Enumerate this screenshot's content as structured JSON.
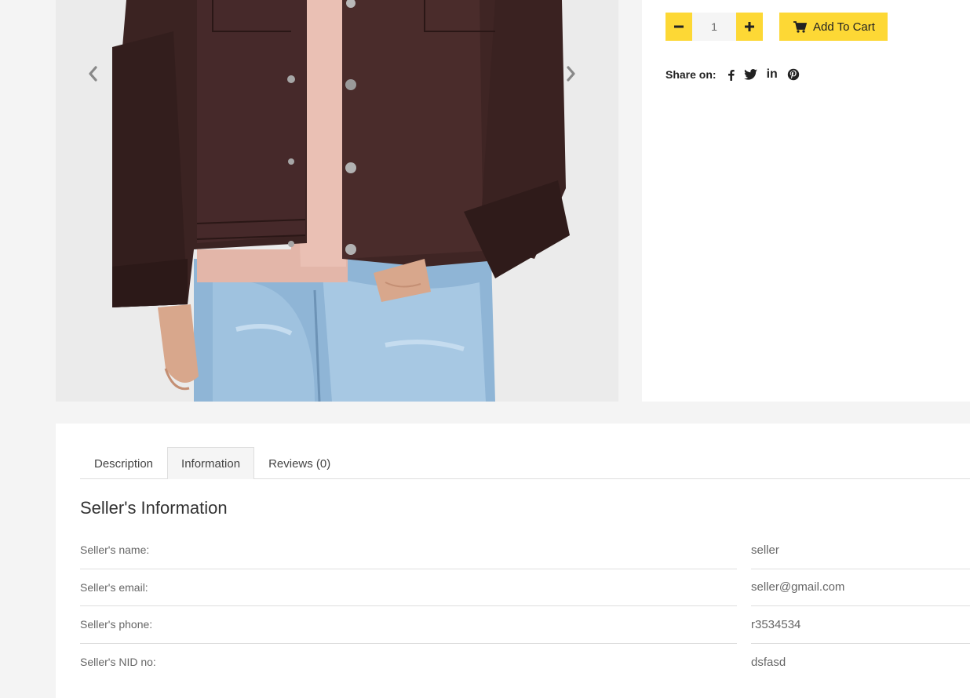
{
  "product": {
    "quantity": "1",
    "add_to_cart_label": "Add To Cart",
    "share_label": "Share on:",
    "social": {
      "linkedin_text": "in"
    }
  },
  "tabs": [
    {
      "label": "Description"
    },
    {
      "label": "Information"
    },
    {
      "label": "Reviews (0)"
    }
  ],
  "active_tab": "Information",
  "seller": {
    "title": "Seller's Information",
    "rows": [
      {
        "label": "Seller's name:",
        "value": "seller"
      },
      {
        "label": "Seller's email:",
        "value": "seller@gmail.com"
      },
      {
        "label": "Seller's phone:",
        "value": "r3534534"
      },
      {
        "label": "Seller's NID no:",
        "value": "dsfasd"
      }
    ]
  },
  "colors": {
    "accent": "#fdd835",
    "page_background": "#f4f4f4",
    "card_background": "#ffffff",
    "text": "#333333",
    "muted_text": "#666666"
  },
  "icons": {
    "prev": "chevron-left-icon",
    "next": "chevron-right-icon",
    "minus": "minus-icon",
    "plus": "plus-icon",
    "cart": "cart-icon",
    "facebook": "facebook-icon",
    "twitter": "twitter-icon",
    "linkedin": "linkedin-icon",
    "pinterest": "pinterest-icon"
  }
}
